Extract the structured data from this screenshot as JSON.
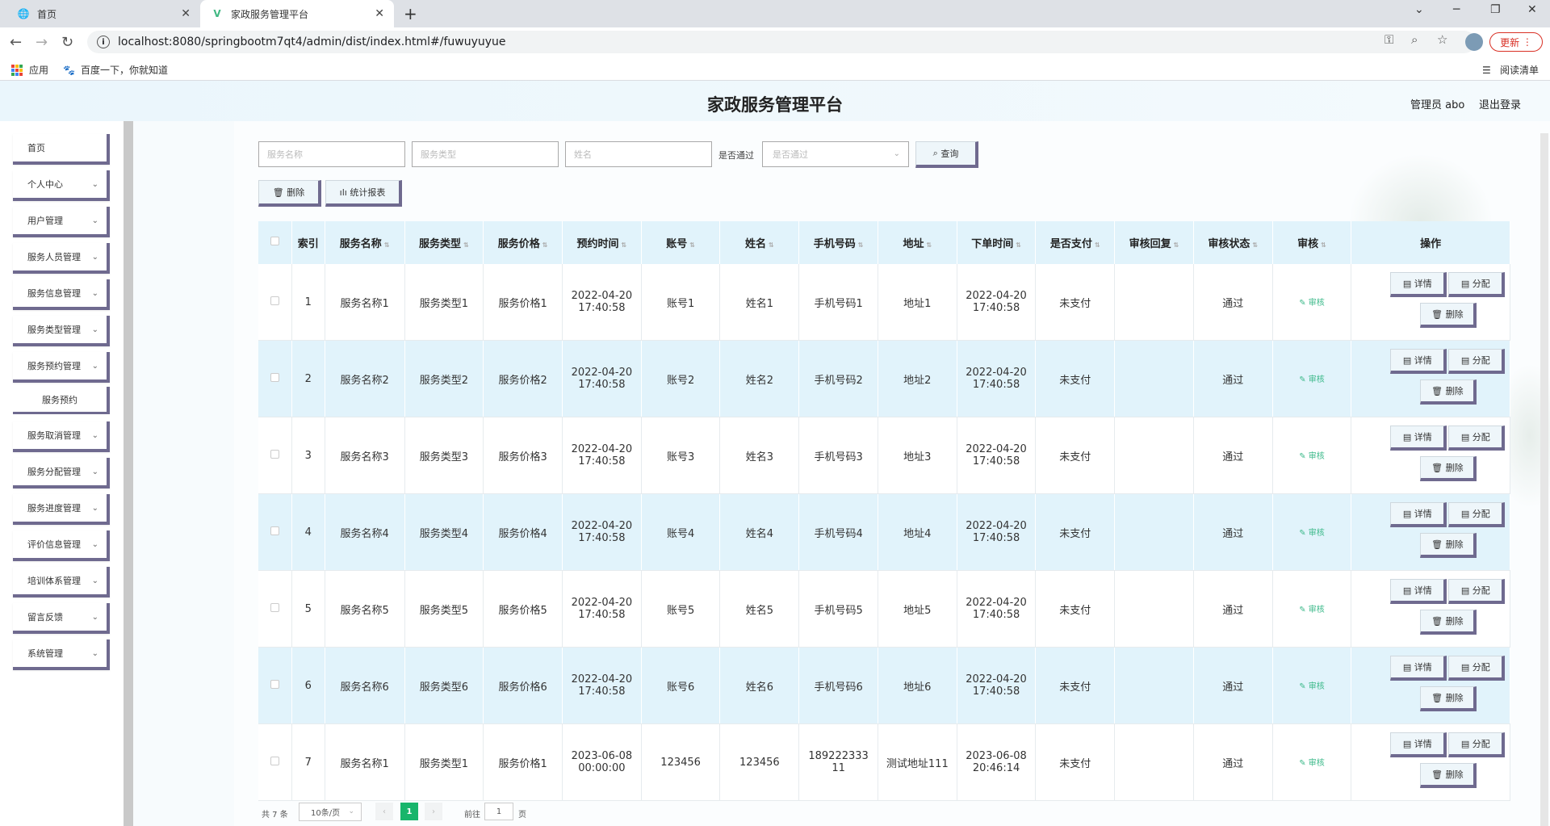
{
  "browser": {
    "tabs": [
      {
        "title": "首页"
      },
      {
        "title": "家政服务管理平台"
      }
    ],
    "url": "localhost:8080/springbootm7qt4/admin/dist/index.html#/fuwuyuyue",
    "update_label": "更新",
    "bookmarks": {
      "apps": "应用",
      "baidu": "百度一下，你就知道",
      "reading_list": "阅读清单"
    }
  },
  "header": {
    "title": "家政服务管理平台",
    "admin": "管理员 abo",
    "logout": "退出登录"
  },
  "sidebar": {
    "items": [
      {
        "label": "首页",
        "has_chevron": false
      },
      {
        "label": "个人中心",
        "has_chevron": true
      },
      {
        "label": "用户管理",
        "has_chevron": true
      },
      {
        "label": "服务人员管理",
        "has_chevron": true
      },
      {
        "label": "服务信息管理",
        "has_chevron": true
      },
      {
        "label": "服务类型管理",
        "has_chevron": true
      },
      {
        "label": "服务预约管理",
        "has_chevron": true
      },
      {
        "label": "服务预约",
        "sub": true
      },
      {
        "label": "服务取消管理",
        "has_chevron": true
      },
      {
        "label": "服务分配管理",
        "has_chevron": true
      },
      {
        "label": "服务进度管理",
        "has_chevron": true
      },
      {
        "label": "评价信息管理",
        "has_chevron": true
      },
      {
        "label": "培训体系管理",
        "has_chevron": true
      },
      {
        "label": "留言反馈",
        "has_chevron": true
      },
      {
        "label": "系统管理",
        "has_chevron": true
      }
    ]
  },
  "search": {
    "service_name_placeholder": "服务名称",
    "service_type_placeholder": "服务类型",
    "name_placeholder": "姓名",
    "passed_label": "是否通过",
    "passed_placeholder": "是否通过",
    "query_label": "查询"
  },
  "actions": {
    "delete_label": "删除",
    "report_label": "统计报表"
  },
  "table": {
    "headers": [
      "索引",
      "服务名称",
      "服务类型",
      "服务价格",
      "预约时间",
      "账号",
      "姓名",
      "手机号码",
      "地址",
      "下单时间",
      "是否支付",
      "审核回复",
      "审核状态",
      "审核",
      "操作"
    ],
    "audit_label": "审核",
    "op_detail": "详情",
    "op_assign": "分配",
    "op_delete": "删除",
    "rows": [
      {
        "index": "1",
        "name": "服务名称1",
        "type": "服务类型1",
        "price": "服务价格1",
        "appt_date": "2022-04-20",
        "appt_time": "17:40:58",
        "account": "账号1",
        "person": "姓名1",
        "phone": "手机号码1",
        "address": "地址1",
        "order_date": "2022-04-20",
        "order_time": "17:40:58",
        "paid": "未支付",
        "reply": "",
        "status": "通过"
      },
      {
        "index": "2",
        "name": "服务名称2",
        "type": "服务类型2",
        "price": "服务价格2",
        "appt_date": "2022-04-20",
        "appt_time": "17:40:58",
        "account": "账号2",
        "person": "姓名2",
        "phone": "手机号码2",
        "address": "地址2",
        "order_date": "2022-04-20",
        "order_time": "17:40:58",
        "paid": "未支付",
        "reply": "",
        "status": "通过"
      },
      {
        "index": "3",
        "name": "服务名称3",
        "type": "服务类型3",
        "price": "服务价格3",
        "appt_date": "2022-04-20",
        "appt_time": "17:40:58",
        "account": "账号3",
        "person": "姓名3",
        "phone": "手机号码3",
        "address": "地址3",
        "order_date": "2022-04-20",
        "order_time": "17:40:58",
        "paid": "未支付",
        "reply": "",
        "status": "通过"
      },
      {
        "index": "4",
        "name": "服务名称4",
        "type": "服务类型4",
        "price": "服务价格4",
        "appt_date": "2022-04-20",
        "appt_time": "17:40:58",
        "account": "账号4",
        "person": "姓名4",
        "phone": "手机号码4",
        "address": "地址4",
        "order_date": "2022-04-20",
        "order_time": "17:40:58",
        "paid": "未支付",
        "reply": "",
        "status": "通过"
      },
      {
        "index": "5",
        "name": "服务名称5",
        "type": "服务类型5",
        "price": "服务价格5",
        "appt_date": "2022-04-20",
        "appt_time": "17:40:58",
        "account": "账号5",
        "person": "姓名5",
        "phone": "手机号码5",
        "address": "地址5",
        "order_date": "2022-04-20",
        "order_time": "17:40:58",
        "paid": "未支付",
        "reply": "",
        "status": "通过"
      },
      {
        "index": "6",
        "name": "服务名称6",
        "type": "服务类型6",
        "price": "服务价格6",
        "appt_date": "2022-04-20",
        "appt_time": "17:40:58",
        "account": "账号6",
        "person": "姓名6",
        "phone": "手机号码6",
        "address": "地址6",
        "order_date": "2022-04-20",
        "order_time": "17:40:58",
        "paid": "未支付",
        "reply": "",
        "status": "通过"
      },
      {
        "index": "7",
        "name": "服务名称1",
        "type": "服务类型1",
        "price": "服务价格1",
        "appt_date": "2023-06-08",
        "appt_time": "00:00:00",
        "account": "123456",
        "person": "123456",
        "phone": "18922233311",
        "address": "测试地址111",
        "order_date": "2023-06-08",
        "order_time": "20:46:14",
        "paid": "未支付",
        "reply": "",
        "status": "通过"
      }
    ]
  },
  "pagination": {
    "total": "共 7 条",
    "page_size": "10条/页",
    "current_page": "1",
    "goto_label": "前往",
    "goto_value": "1",
    "page_suffix": "页"
  },
  "colors": {
    "accent": "#18b56b",
    "row_alt": "#e1f3fb",
    "button_border": "#6f6a8f",
    "audit_link": "#3cb98a"
  }
}
